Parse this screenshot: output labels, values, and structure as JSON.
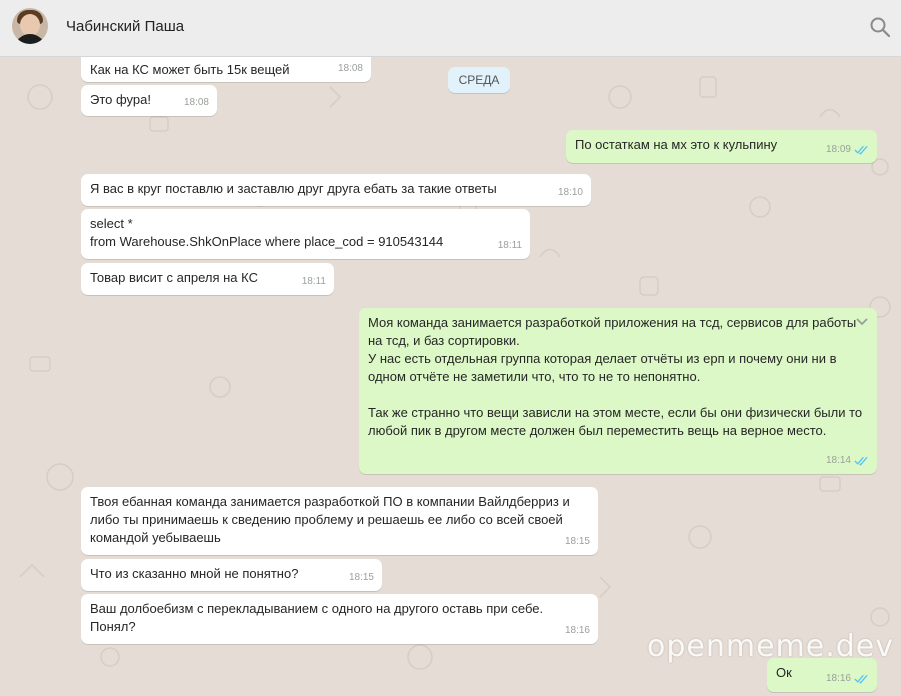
{
  "header": {
    "contact_name": "Чабинский Паша"
  },
  "day_separator": "СРЕДА",
  "messages": [
    {
      "dir": "in",
      "text": "Как на КС может быть 15к вещей",
      "time": "18:08"
    },
    {
      "dir": "in",
      "text": "Это фура!",
      "time": "18:08"
    },
    {
      "dir": "out",
      "text": "По остаткам на мх это к кульпину",
      "time": "18:09"
    },
    {
      "dir": "in",
      "text": "Я вас в круг поставлю и заставлю друг друга ебать за такие ответы",
      "time": "18:10"
    },
    {
      "dir": "in",
      "text": "select *\nfrom Warehouse.ShkOnPlace where place_cod = 910543144",
      "time": "18:11"
    },
    {
      "dir": "in",
      "text": "Товар висит с апреля на КС",
      "time": "18:11"
    },
    {
      "dir": "out",
      "text": "Моя команда занимается разработкой приложения на тсд, сервисов для работы на тсд, и баз сортировки.\nУ нас есть отдельная группа которая делает отчёты из ерп и почему они ни в одном отчёте не заметили что, что то не то непонятно.\n\nТак же странно что вещи зависли на этом месте, если бы они физически были то любой пик в другом месте должен был переместить вещь на верное место.",
      "time": "18:14"
    },
    {
      "dir": "in",
      "text": "Твоя ебанная команда занимается разработкой ПО в компании Вайлдберриз и либо ты принимаешь к сведению проблему и решаешь ее либо со всей своей командой уебываешь",
      "time": "18:15"
    },
    {
      "dir": "in",
      "text": "Что из сказанно мной не понятно?",
      "time": "18:15"
    },
    {
      "dir": "in",
      "text": "Ваш долбоебизм с перекладыванием с одного на другого оставь при себе.\nПонял?",
      "time": "18:16"
    },
    {
      "dir": "out",
      "text": "Ок",
      "time": "18:16"
    }
  ],
  "watermark": "openmeme.dev",
  "colors": {
    "incoming": "#ffffff",
    "outgoing": "#dcf8c6",
    "read_ticks": "#4fc3f7",
    "chat_bg": "#e5ddd5"
  },
  "icons": [
    "search-icon",
    "double-check-icon",
    "chevron-down-icon"
  ]
}
